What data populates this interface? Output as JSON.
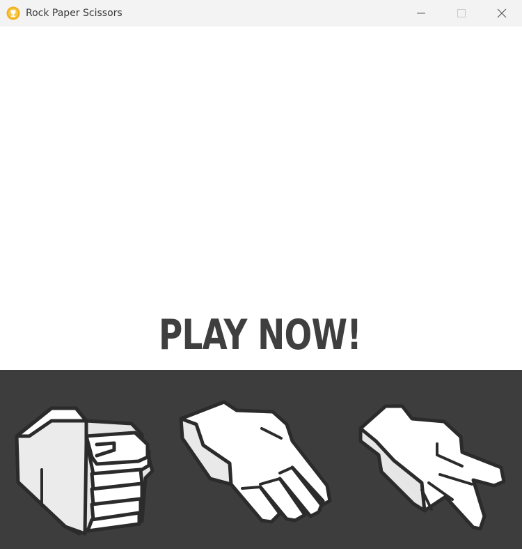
{
  "window": {
    "title": "Rock Paper Scissors",
    "app_icon": "trophy-icon",
    "controls": [
      "minimize-icon",
      "maximize-icon",
      "close-icon"
    ]
  },
  "main": {
    "headline": "PLAY NOW!"
  },
  "hands": [
    {
      "name": "rock",
      "icon": "rock-hand-icon"
    },
    {
      "name": "paper",
      "icon": "paper-hand-icon"
    },
    {
      "name": "scissors",
      "icon": "scissors-hand-icon"
    }
  ],
  "colors": {
    "panel_background": "#3d3d3d",
    "headline": "#3f3f3f",
    "hand_fill": "#ffffff",
    "hand_shadow": "#e6e6e6",
    "hand_outline": "#2b2b2b",
    "title_bar": "#f3f3f3"
  }
}
